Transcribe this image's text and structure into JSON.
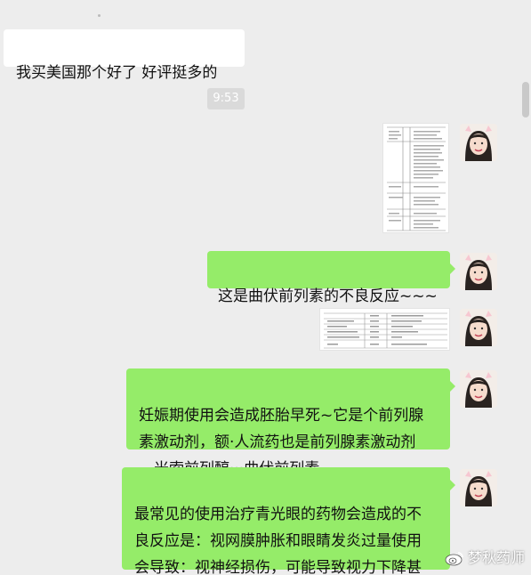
{
  "messages": {
    "m1": {
      "text": "我买美国那个好了 好评挺多的"
    },
    "timestamp": "9:53",
    "m2": {
      "text": "这是曲伏前列素的不良反应~~~"
    },
    "m3": {
      "text": "妊娠期使用会造成胚胎早死~它是个前列腺\n素激动剂，额·人流药也是前列腺素激动剂\n。米索前列醇···曲伏前列素~"
    },
    "m4": {
      "text": "最常见的使用治疗青光眼的药物会造成的不\n良反应是：视网膜肿胀和眼睛发炎过量使用\n会导致：视神经损伤，可能导致视力下降甚\n至失明。"
    }
  },
  "watermark": "梦秋药师",
  "colors": {
    "background": "#ededed",
    "incoming_bubble": "#ffffff",
    "outgoing_bubble": "#95ec69"
  },
  "icons": {
    "avatar": "user-avatar",
    "watermark": "weibo-icon"
  }
}
